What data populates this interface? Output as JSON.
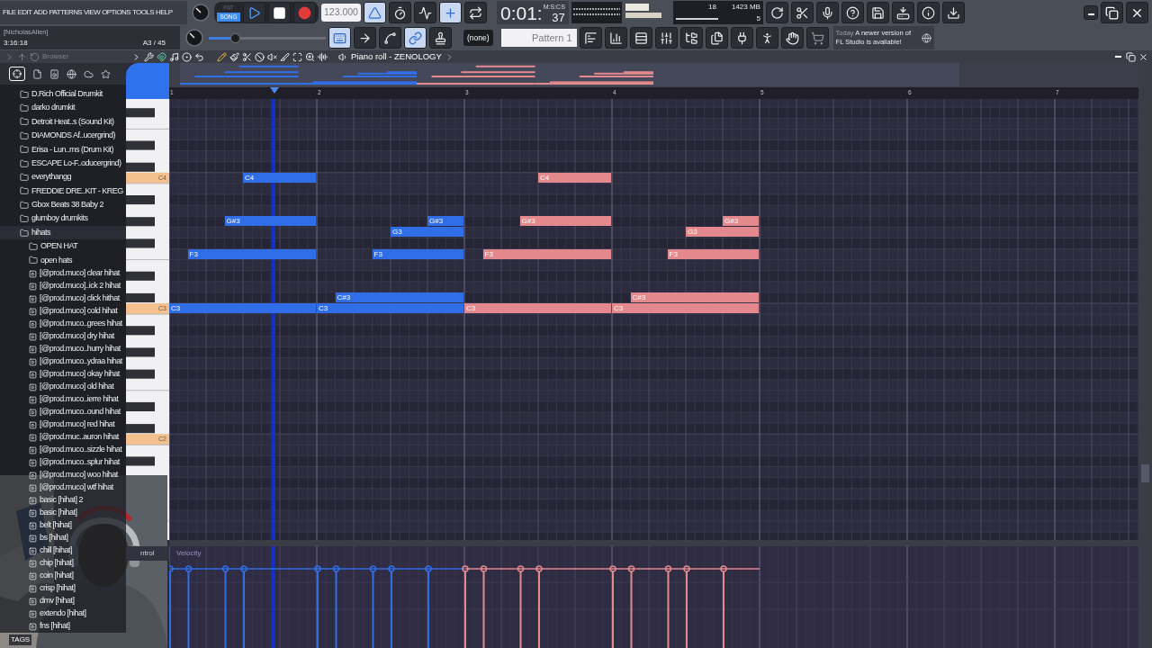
{
  "menu": [
    "FILE",
    "EDIT",
    "ADD",
    "PATTERNS",
    "VIEW",
    "OPTIONS",
    "TOOLS",
    "HELP"
  ],
  "user": {
    "name": "[NicholasAllen]",
    "time": "3:16:18",
    "position": "A3 / 45"
  },
  "transport": {
    "modes": [
      {
        "label": "PAT",
        "selected": false
      },
      {
        "label": "SONG",
        "selected": true
      }
    ],
    "tempo": "123.000"
  },
  "clock": {
    "value": "0:01:",
    "centis": "37",
    "unit": "M:S:CS"
  },
  "cpu": {
    "voices": "18",
    "memory": "1423 MB",
    "polyphony": "5"
  },
  "pattern": {
    "channel": "(none)",
    "name": "Pattern 1"
  },
  "news": {
    "date": "Today",
    "message": "A newer version of FL Studio is available!"
  },
  "browser": {
    "title": "Browser",
    "items": [
      {
        "label": "D.Rich Official Drumkit",
        "kind": "folder"
      },
      {
        "label": "darko drumkit",
        "kind": "folder"
      },
      {
        "label": "Detroit Heat..s (Sound Kit)",
        "kind": "folder"
      },
      {
        "label": "DIAMONDS Af..ucergrind)",
        "kind": "folder"
      },
      {
        "label": "Erisa - Lun..ms (Drum Kit)",
        "kind": "folder"
      },
      {
        "label": "ESCAPE Lo-F..oducergrind)",
        "kind": "folder"
      },
      {
        "label": "everythangg",
        "kind": "folder"
      },
      {
        "label": "FREDDIE DRE..KIT - KREG",
        "kind": "folder"
      },
      {
        "label": "Gbox Beats 38 Baby 2",
        "kind": "folder"
      },
      {
        "label": "glumboy drumkits",
        "kind": "folder"
      },
      {
        "label": "hihats",
        "kind": "folder",
        "children": [
          {
            "label": "OPEN HAT",
            "kind": "folder"
          },
          {
            "label": "open hats",
            "kind": "folder"
          },
          {
            "label": "[@prod.muco] clear hihat",
            "kind": "file"
          },
          {
            "label": "[@prod.muco]..ick 2 hihat",
            "kind": "file"
          },
          {
            "label": "[@prod.muco] click hithat",
            "kind": "file"
          },
          {
            "label": "[@prod.muco] cold hihat",
            "kind": "file"
          },
          {
            "label": "[@prod.muco..grees hihat",
            "kind": "file"
          },
          {
            "label": "[@prod.muco] dry hihat",
            "kind": "file"
          },
          {
            "label": "[@prod.muco..hurry hihat",
            "kind": "file"
          },
          {
            "label": "[@prod.muco..ydraa hihat",
            "kind": "file"
          },
          {
            "label": "[@prod.muco] okay hihat",
            "kind": "file"
          },
          {
            "label": "[@prod.muco] old hihat",
            "kind": "file"
          },
          {
            "label": "[@prod.muco..ierre hihat",
            "kind": "file"
          },
          {
            "label": "[@prod.muco..ound hihat",
            "kind": "file"
          },
          {
            "label": "[@prod.muco] red hihat",
            "kind": "file"
          },
          {
            "label": "[@prod.muc..auron hihat",
            "kind": "file"
          },
          {
            "label": "[@prod.muco..sizzle hihat",
            "kind": "file"
          },
          {
            "label": "[@prod.muco..splur hihat",
            "kind": "file"
          },
          {
            "label": "[@prod.muco] woo hihat",
            "kind": "file"
          },
          {
            "label": "[@prod.muco] wtf hihat",
            "kind": "file"
          },
          {
            "label": "basic [hihat] 2",
            "kind": "file"
          },
          {
            "label": "basic [hihat]",
            "kind": "file"
          },
          {
            "label": "belt [hihat]",
            "kind": "file"
          },
          {
            "label": "bs [hihat]",
            "kind": "file"
          },
          {
            "label": "chill [hihat]",
            "kind": "file"
          },
          {
            "label": "chip [hihat]",
            "kind": "file"
          },
          {
            "label": "coin [hihat]",
            "kind": "file"
          },
          {
            "label": "crisp [hihat]",
            "kind": "file"
          },
          {
            "label": "dmv [hihat]",
            "kind": "file"
          },
          {
            "label": "extendo [hihat]",
            "kind": "file"
          },
          {
            "label": "fns [hihat]",
            "kind": "file"
          }
        ]
      }
    ],
    "tags": "TAGS"
  },
  "master": {
    "level": 0.2
  },
  "piano_roll": {
    "title": "Piano roll - ZENOLOGY",
    "bars": [
      "1",
      "2",
      "3",
      "4",
      "5",
      "6",
      "7"
    ],
    "keys": [
      "C4",
      "C3",
      "C2"
    ],
    "notes": [
      {
        "label": "C4",
        "color": "#2f6ee6"
      },
      {
        "label": "G#3",
        "color": "#2f6ee6"
      },
      {
        "label": "F3",
        "color": "#2f6ee6"
      },
      {
        "label": "C3",
        "color": "#2f6ee6"
      },
      {
        "label": "C3",
        "color": "#2f6ee6"
      },
      {
        "label": "C#3",
        "color": "#2f6ee6"
      },
      {
        "label": "F3",
        "color": "#2f6ee6"
      },
      {
        "label": "G3",
        "color": "#2f6ee6"
      },
      {
        "label": "G#3",
        "color": "#2f6ee6"
      },
      {
        "label": "C3",
        "color": "#e3898e"
      },
      {
        "label": "F3",
        "color": "#e3898e"
      },
      {
        "label": "G#3",
        "color": "#e3898e"
      },
      {
        "label": "C4",
        "color": "#e3898e"
      },
      {
        "label": "C3",
        "color": "#e3898e"
      },
      {
        "label": "C#3",
        "color": "#e3898e"
      },
      {
        "label": "F3",
        "color": "#e3898e"
      },
      {
        "label": "G3",
        "color": "#e3898e"
      },
      {
        "label": "G#3",
        "color": "#e3898e"
      }
    ],
    "control": {
      "label": "ntrol",
      "lane": "Velocity"
    }
  }
}
